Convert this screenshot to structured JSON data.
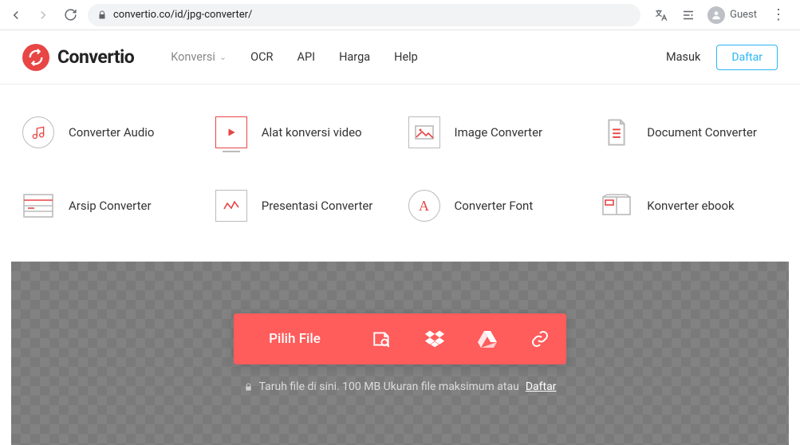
{
  "browser": {
    "url": "convertio.co/id/jpg-converter/",
    "guest_label": "Guest"
  },
  "header": {
    "brand": "Convertio",
    "nav": {
      "konversi": "Konversi",
      "ocr": "OCR",
      "api": "API",
      "harga": "Harga",
      "help": "Help"
    },
    "login": "Masuk",
    "signup": "Daftar"
  },
  "categories": {
    "audio": "Converter Audio",
    "video": "Alat konversi video",
    "image": "Image Converter",
    "document": "Document Converter",
    "archive": "Arsip Converter",
    "presentation": "Presentasi Converter",
    "font": "Converter Font",
    "ebook": "Konverter ebook"
  },
  "dropzone": {
    "choose": "Pilih File",
    "caption_prefix": "Taruh file di sini. 100 MB Ukuran file maksimum atau",
    "caption_link": "Daftar"
  }
}
